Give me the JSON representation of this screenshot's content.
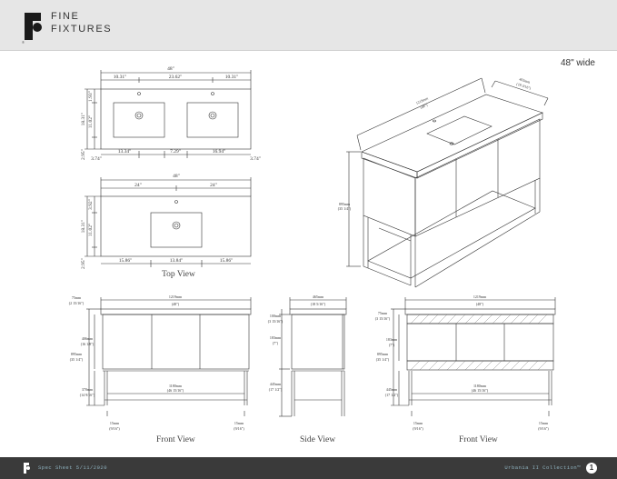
{
  "brand": {
    "line1": "FINE",
    "line2": "FIXTURES",
    "reg": "®"
  },
  "width_label": "48\" wide",
  "captions": {
    "top_view": "Top View",
    "front_view_1": "Front View",
    "side_view": "Side View",
    "front_view_2": "Front View"
  },
  "footer": {
    "left": "Spec Sheet 5/11/2020",
    "right": "Urbania II Collection™",
    "page": "1"
  },
  "top_double": {
    "overall": "48\"",
    "seg1": "10.31\"",
    "seg2": "23.62\"",
    "seg3": "10.31\"",
    "b1": "13.34\"",
    "b2": "7.29\"",
    "b3": "16.94\"",
    "left_edge": "3.74\"",
    "right_edge": "3.74\"",
    "h_total": "18.31\"",
    "h_inner": "11.02\"",
    "h_top": "1.93\"",
    "h_bot": "2.95\""
  },
  "top_single": {
    "overall": "48\"",
    "half1": "24\"",
    "half2": "24\"",
    "b1": "15.86\"",
    "b2": "13.84\"",
    "b3": "15.86\"",
    "h_total": "18.31\"",
    "h_inner": "11.02\"",
    "h_top": "3.92\"",
    "h_bot": "2.95\""
  },
  "iso": {
    "w": "1219mm",
    "w_in": "(48\")",
    "d": "465mm",
    "d_in": "(18 3/16\")",
    "h": "895mm",
    "h_in": "(35 1/4\")"
  },
  "front1": {
    "overall": "1219mm",
    "overall_in": "(48\")",
    "top": "75mm",
    "top_in": "(2 15/16\")",
    "h": "895mm",
    "h_in": "(35 1/4\")",
    "cab": "406mm",
    "cab_in": "(16 1/8\")",
    "open": "370mm",
    "open_in": "(14 9/16\")",
    "inner": "1180mm",
    "inner_in": "(46 15/16\")",
    "leg1": "15mm",
    "leg1_in": "(9/16\")",
    "leg2": "15mm",
    "leg2_in": "(9/16\")"
  },
  "side": {
    "overall": "465mm",
    "overall_in": "(18 5/16\")",
    "top": "100mm",
    "top_in": "(3 15/16\")",
    "mid": "183mm",
    "mid_in": "(7\")",
    "bot": "445mm",
    "bot_in": "(17 1/2\")"
  },
  "front2": {
    "overall": "1219mm",
    "overall_in": "(48\")",
    "top": "75mm",
    "top_in": "(3 15/16\")",
    "h": "895mm",
    "h_in": "(35 1/4\")",
    "cab": "183mm",
    "cab_in": "(7\")",
    "open": "445mm",
    "open_in": "(17 1/2\")",
    "inner": "1180mm",
    "inner_in": "(46 15/16\")",
    "leg1": "15mm",
    "leg1_in": "(9/16\")",
    "leg2": "15mm",
    "leg2_in": "(9/16\")"
  }
}
